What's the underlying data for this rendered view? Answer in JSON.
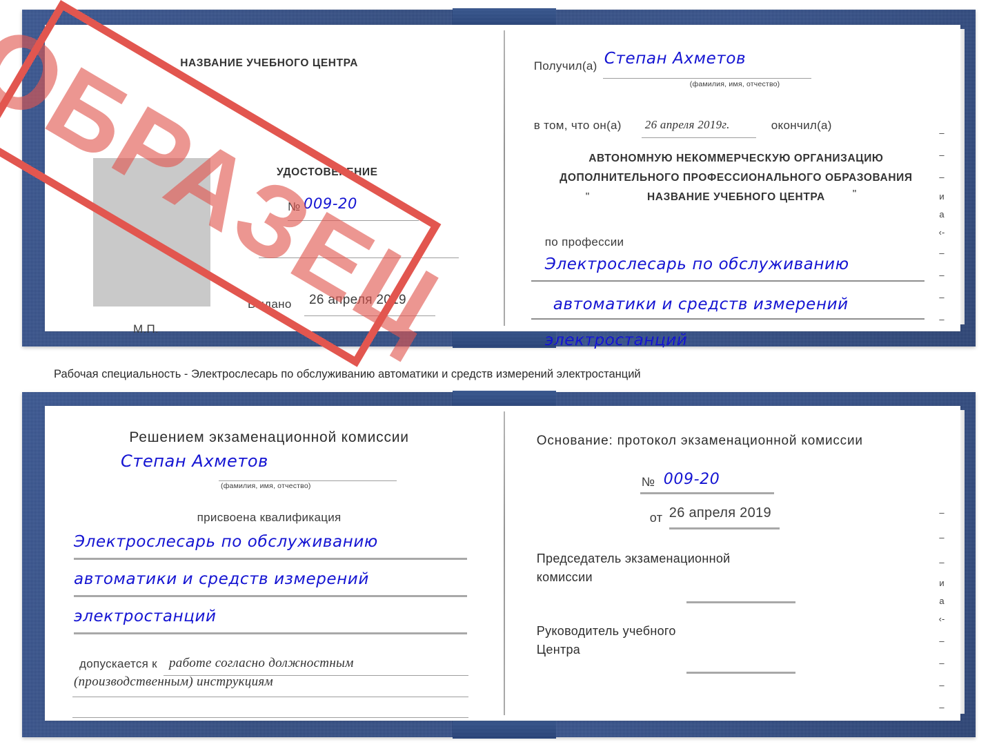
{
  "caption": {
    "text": "Рабочая специальность - Электрослесарь по обслуживанию автоматики и средств измерений электростанций"
  },
  "stamp": {
    "label": "ОБРАЗЕЦ",
    "color": "#e2564f"
  },
  "colors": {
    "cover_blue": "#2b4a8a",
    "handwriting_blue": "#1414d2",
    "photo_placeholder_gray": "#c9c9c9",
    "page_white": "#ffffff"
  },
  "certificate_top": {
    "left_page": {
      "header": "НАЗВАНИЕ УЧЕБНОГО ЦЕНТРА",
      "doc_type": "УДОСТОВЕРЕНИЕ",
      "number_label": "№",
      "number_value": "009-20",
      "issued_label": "Выдано",
      "issued_value": "26 апреля 2019",
      "seal_label": "М.П.",
      "photo_placeholder": ""
    },
    "right_page": {
      "received_label": "Получил(а)",
      "received_value": "Степан Ахметов",
      "name_hint": "(фамилия, имя, отчество)",
      "in_that_label": "в том, что он(а)",
      "completion_date": "26 апреля 2019г.",
      "finished_label": "окончил(а)",
      "org_line1": "АВТОНОМНУЮ НЕКОММЕРЧЕСКУЮ ОРГАНИЗАЦИЮ",
      "org_line2": "ДОПОЛНИТЕЛЬНОГО ПРОФЕССИОНАЛЬНОГО ОБРАЗОВАНИЯ",
      "org_quote_open": "\"",
      "org_line3": "НАЗВАНИЕ УЧЕБНОГО ЦЕНТРА",
      "org_quote_close": "\"",
      "profession_label": "по профессии",
      "profession_line1": "Электрослесарь по обслуживанию",
      "profession_line2": "автоматики и средств измерений",
      "profession_line3": "электростанций",
      "edge_marks": [
        "–",
        "–",
        "–",
        "и",
        "а",
        "‹-",
        "–",
        "–",
        "–",
        "–"
      ]
    }
  },
  "certificate_bottom": {
    "left_page": {
      "header": "Решением экзаменационной комиссии",
      "name_value": "Степан Ахметов",
      "name_hint": "(фамилия, имя, отчество)",
      "qualification_label": "присвоена квалификация",
      "qualification_line1": "Электрослесарь по обслуживанию",
      "qualification_line2": "автоматики и средств измерений",
      "qualification_line3": "электростанций",
      "admitted_label": "допускается к",
      "admitted_value_line1": "работе согласно должностным",
      "admitted_value_line2": "(производственным) инструкциям"
    },
    "right_page": {
      "basis_label": "Основание: протокол экзаменационной комиссии",
      "number_label": "№",
      "number_value": "009-20",
      "date_label": "от",
      "date_value": "26 апреля 2019",
      "chairman_line1": "Председатель экзаменационной",
      "chairman_line2": "комиссии",
      "head_line1": "Руководитель учебного",
      "head_line2": "Центра",
      "edge_marks": [
        "–",
        "–",
        "–",
        "и",
        "а",
        "‹-",
        "–",
        "–",
        "–",
        "–"
      ]
    }
  }
}
